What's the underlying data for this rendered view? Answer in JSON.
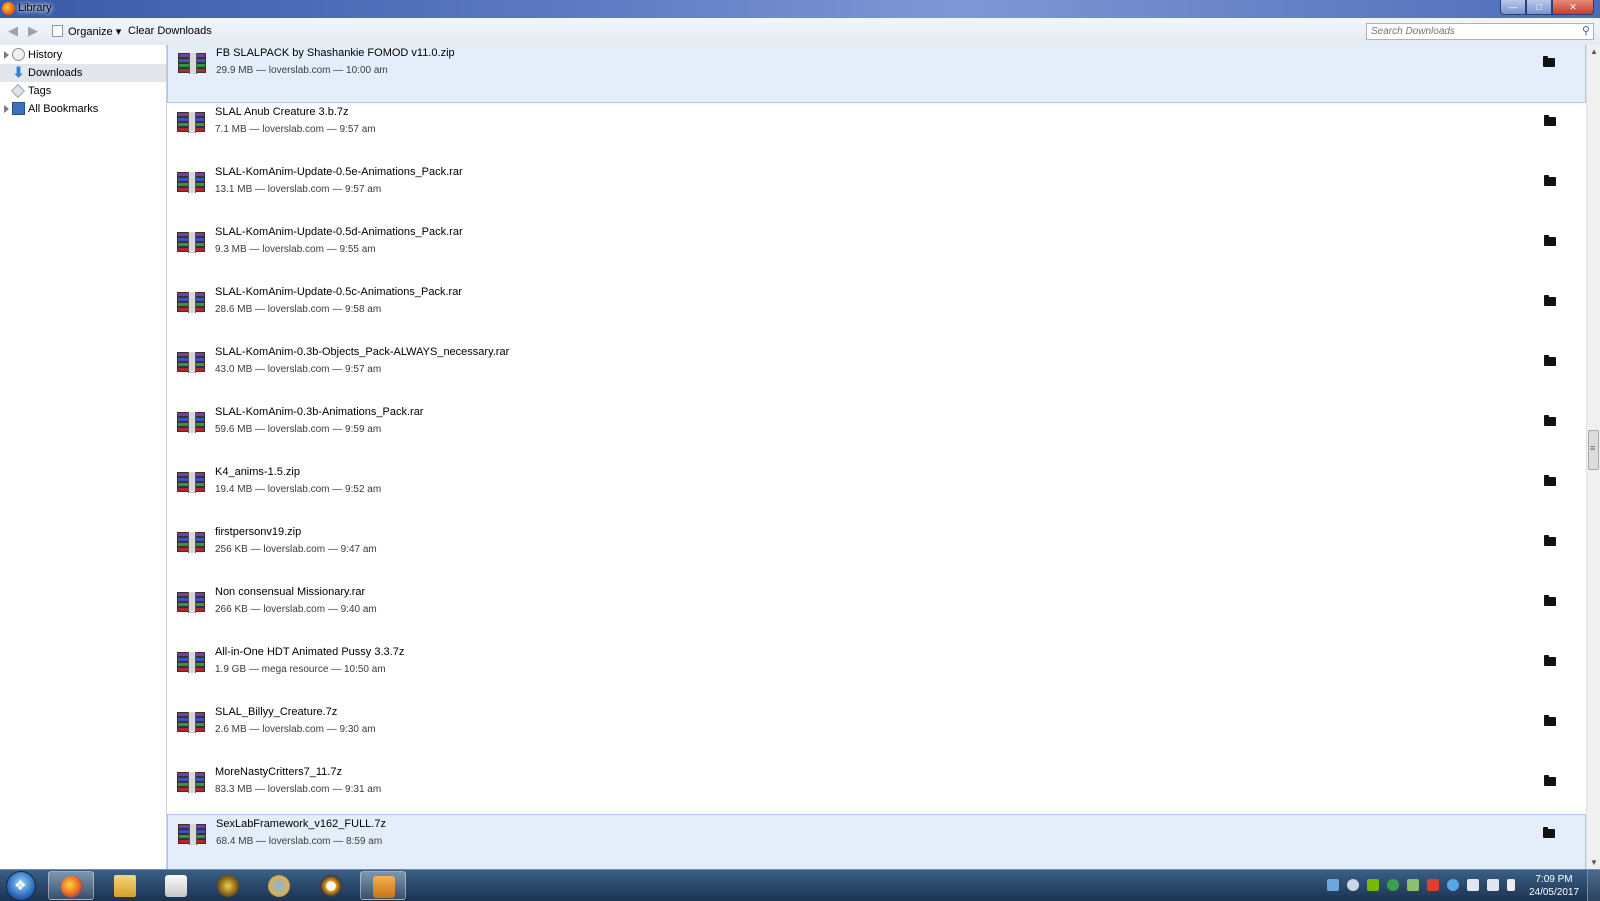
{
  "window": {
    "title": "Library"
  },
  "toolbar": {
    "back_icon": "back-arrow-icon",
    "forward_icon": "forward-arrow-icon",
    "organize_label": "Organize",
    "clear_downloads_label": "Clear Downloads",
    "search_placeholder": "Search Downloads"
  },
  "sidebar": {
    "items": [
      {
        "label": "History",
        "icon": "history-clock-icon",
        "expandable": true
      },
      {
        "label": "Downloads",
        "icon": "download-arrow-icon",
        "selected": true
      },
      {
        "label": "Tags",
        "icon": "tag-icon"
      },
      {
        "label": "All Bookmarks",
        "icon": "bookmarks-icon",
        "expandable": true
      }
    ]
  },
  "downloads": [
    {
      "name": "FB SLALPACK by Shashankie FOMOD v11.0.zip",
      "meta": "29.9 MB — loverslab.com — 10:00 am",
      "selected": true
    },
    {
      "name": "SLAL Anub Creature 3.b.7z",
      "meta": "7.1 MB — loverslab.com — 9:57 am"
    },
    {
      "name": "SLAL-KomAnim-Update-0.5e-Animations_Pack.rar",
      "meta": "13.1 MB — loverslab.com — 9:57 am"
    },
    {
      "name": "SLAL-KomAnim-Update-0.5d-Animations_Pack.rar",
      "meta": "9.3 MB — loverslab.com — 9:55 am"
    },
    {
      "name": "SLAL-KomAnim-Update-0.5c-Animations_Pack.rar",
      "meta": "28.6 MB — loverslab.com — 9:58 am"
    },
    {
      "name": "SLAL-KomAnim-0.3b-Objects_Pack-ALWAYS_necessary.rar",
      "meta": "43.0 MB — loverslab.com — 9:57 am"
    },
    {
      "name": "SLAL-KomAnim-0.3b-Animations_Pack.rar",
      "meta": "59.6 MB — loverslab.com — 9:59 am"
    },
    {
      "name": "K4_anims-1.5.zip",
      "meta": "19.4 MB — loverslab.com — 9:52 am"
    },
    {
      "name": "firstpersonv19.zip",
      "meta": "256 KB — loverslab.com — 9:47 am"
    },
    {
      "name": "Non consensual Missionary.rar",
      "meta": "266 KB — loverslab.com — 9:40 am"
    },
    {
      "name": "All-in-One HDT Animated Pussy 3.3.7z",
      "meta": "1.9 GB — mega resource — 10:50 am"
    },
    {
      "name": "SLAL_Billyy_Creature.7z",
      "meta": "2.6 MB — loverslab.com — 9:30 am"
    },
    {
      "name": "MoreNastyCritters7_11.7z",
      "meta": "83.3 MB — loverslab.com — 9:31 am"
    },
    {
      "name": "SexLabFramework_v162_FULL.7z",
      "meta": "68.4 MB — loverslab.com — 8:59 am",
      "selected": true
    }
  ],
  "taskbar": {
    "apps": [
      "firefox-icon",
      "file-explorer-icon",
      "media-player-icon",
      "world-of-warcraft-icon",
      "settings-gear-icon",
      "overwatch-icon",
      "x-app-icon"
    ],
    "clock_time": "7:09 PM",
    "clock_date": "24/05/2017"
  }
}
